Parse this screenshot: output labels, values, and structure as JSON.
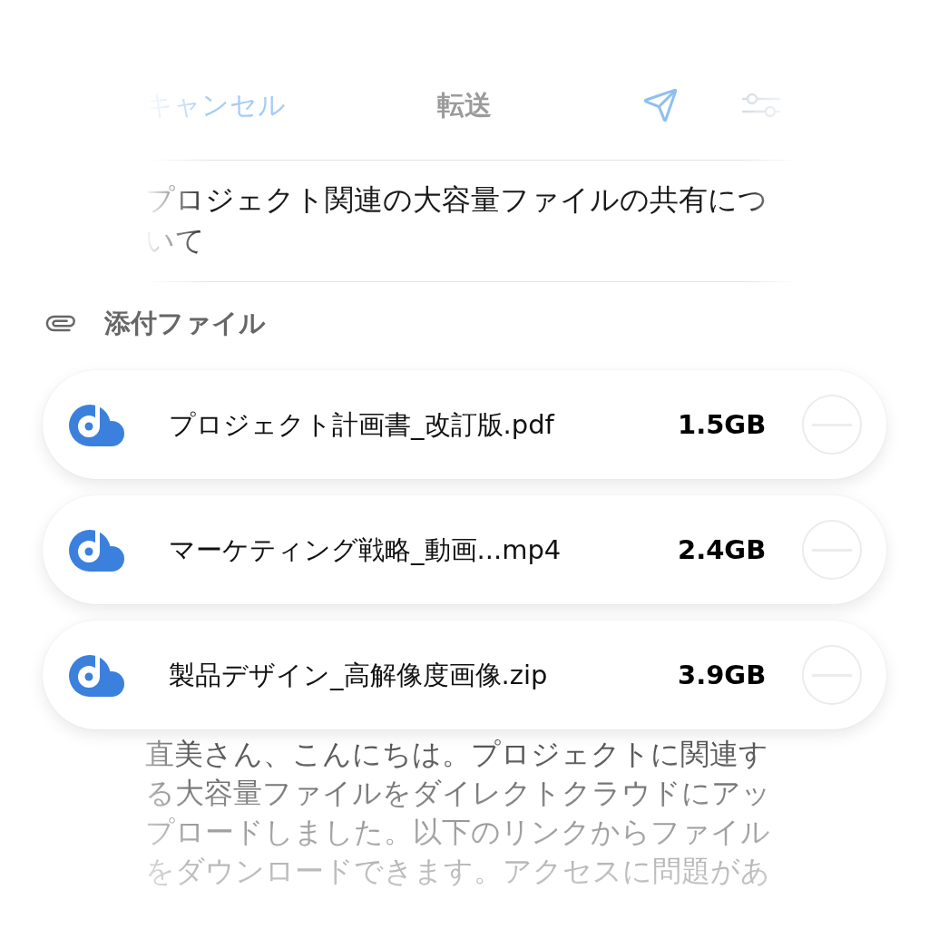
{
  "compose": {
    "cancel": "キャンセル",
    "title": "転送",
    "subject": "プロジェクト関連の大容量ファイルの共有について"
  },
  "attachments": {
    "heading": "添付ファイル",
    "files": [
      {
        "name": "プロジェクト計画書_改訂版.pdf",
        "size": "1.5GB"
      },
      {
        "name": "マーケティング戦略_動画...mp4",
        "size": "2.4GB"
      },
      {
        "name": "製品デザイン_高解像度画像.zip",
        "size": "3.9GB"
      }
    ]
  },
  "body": "直美さん、こんにちは。プロジェクトに関連する大容量ファイルをダイレクトクラウドにアップロードしました。以下のリンクからファイルをダウンロードできます。アクセスに問題があ"
}
